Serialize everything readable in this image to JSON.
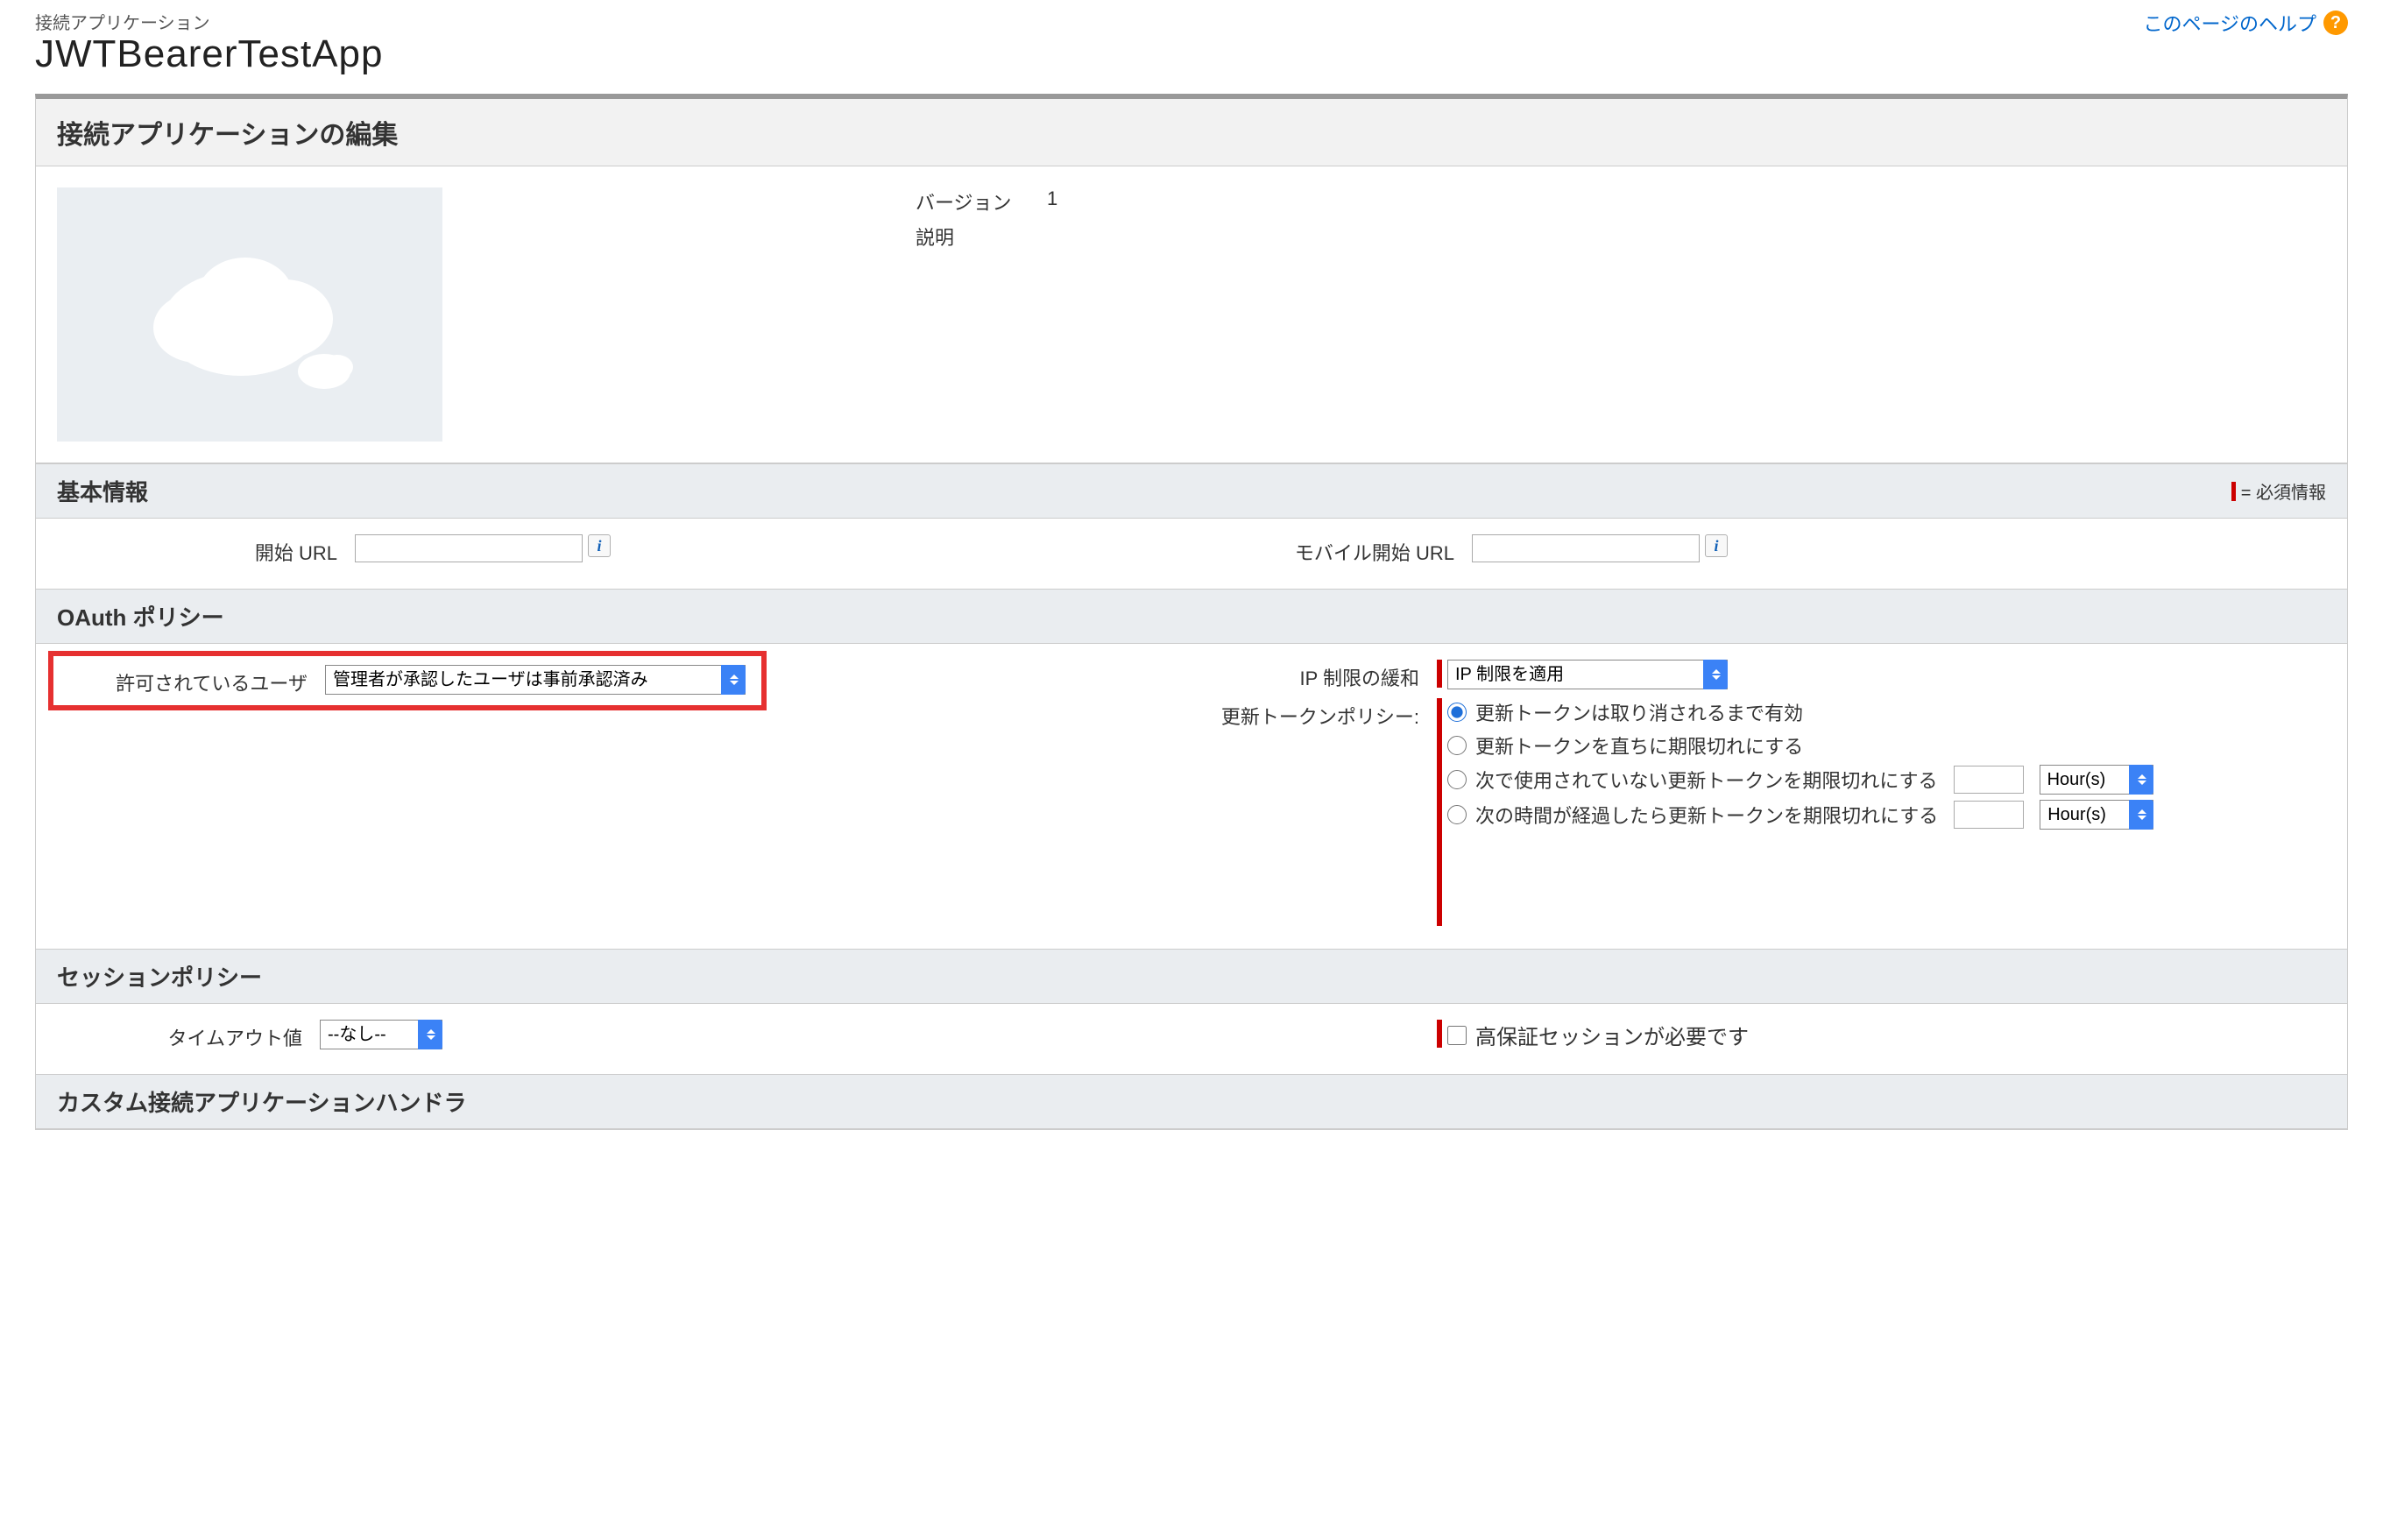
{
  "header": {
    "breadcrumb": "接続アプリケーション",
    "app_title": "JWTBearerTestApp",
    "help_link": "このページのヘルプ"
  },
  "panel": {
    "title": "接続アプリケーションの編集",
    "meta": {
      "version_label": "バージョン",
      "version_value": "1",
      "description_label": "説明",
      "description_value": ""
    }
  },
  "basic_info": {
    "header": "基本情報",
    "required_legend": "= 必須情報",
    "start_url_label": "開始 URL",
    "start_url_value": "",
    "mobile_start_url_label": "モバイル開始 URL",
    "mobile_start_url_value": ""
  },
  "oauth_policies": {
    "header": "OAuth ポリシー",
    "permitted_users_label": "許可されているユーザ",
    "permitted_users_value": "管理者が承認したユーザは事前承認済み",
    "ip_relaxation_label": "IP 制限の緩和",
    "ip_relaxation_value": "IP 制限を適用",
    "refresh_token_label": "更新トークンポリシー:",
    "refresh_options": {
      "opt1": "更新トークンは取り消されるまで有効",
      "opt2": "更新トークンを直ちに期限切れにする",
      "opt3_prefix": "次で使用されていない更新トークンを期限切れにする",
      "opt4_prefix": "次の時間が経過したら更新トークンを期限切れにする",
      "unit_value": "Hour(s)",
      "num_value": ""
    }
  },
  "session_policies": {
    "header": "セッションポリシー",
    "timeout_label": "タイムアウト値",
    "timeout_value": "--なし--",
    "high_assurance_label": "高保証セッションが必要です"
  },
  "custom_handler": {
    "header": "カスタム接続アプリケーションハンドラ"
  }
}
